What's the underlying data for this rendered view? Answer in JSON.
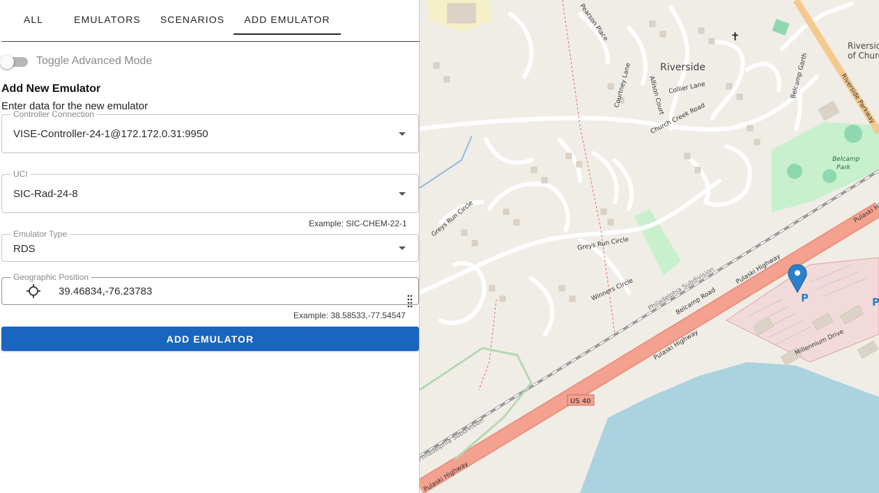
{
  "tabs": [
    {
      "label": "ALL",
      "active": false
    },
    {
      "label": "EMULATORS",
      "active": false
    },
    {
      "label": "SCENARIOS",
      "active": false
    },
    {
      "label": "ADD EMULATOR",
      "active": true
    }
  ],
  "advanced_mode": {
    "label": "Toggle Advanced Mode",
    "enabled": false
  },
  "form": {
    "title": "Add New Emulator",
    "subtitle": "Enter data for the new emulator",
    "controller_connection": {
      "label": "Controller Connection",
      "value": "VISE-Controller-24-1@172.172.0.31:9950"
    },
    "uci": {
      "label": "UCI",
      "value": "SIC-Rad-24-8",
      "hint": "Example: SIC-CHEM-22-1"
    },
    "emulator_type": {
      "label": "Emulator Type",
      "value": "RDS"
    },
    "geographic_position": {
      "label": "Geographic Position",
      "value": "39.46834,-76.23783",
      "hint": "Example: 38.58533,-77.54547"
    },
    "submit_label": "ADD EMULATOR"
  },
  "map": {
    "labels": {
      "riverside": "Riverside",
      "riverside_church": "Riverside",
      "of_church": "of Church",
      "pearson_place": "Pearson Place",
      "courtney_lane": "Courtney Lane",
      "allison_court": "Allison Court",
      "collier_lane": "Collier Lane",
      "church_creek_road": "Church Creek Road",
      "belcamp_garth": "Belcamp Garth",
      "riverside_parkway": "Riverside Parkway",
      "belcamp": "Belcamp",
      "park": "Park",
      "greys_run_circle_1": "Greys Run Circle",
      "greys_run_circle_2": "Greys Run Circle",
      "winners_circle": "Winners Circle",
      "philadelphia_subdivision_1": "Philadelphia Subdivision",
      "philadelphia_subdivision_2": "Philadelphia Subdivision",
      "belcamp_road": "Belcamp Road",
      "pulaski_highway_1": "Pulaski Highway",
      "pulaski_highway_2": "Pulaski Highway",
      "pulaski_highway_3": "Pulaski Highway",
      "pulaski_highway_4": "Pulaski Highway",
      "millennium_drive": "Millennium Drive",
      "us40": "US 40",
      "parking_1": "P",
      "parking_2": "P"
    },
    "colors": {
      "background": "#f0ede7",
      "water": "#aad3df",
      "park": "#c8f0cd",
      "highway": "#e8917f",
      "building": "#dcd3c8",
      "marker": "#2a81cb"
    }
  }
}
